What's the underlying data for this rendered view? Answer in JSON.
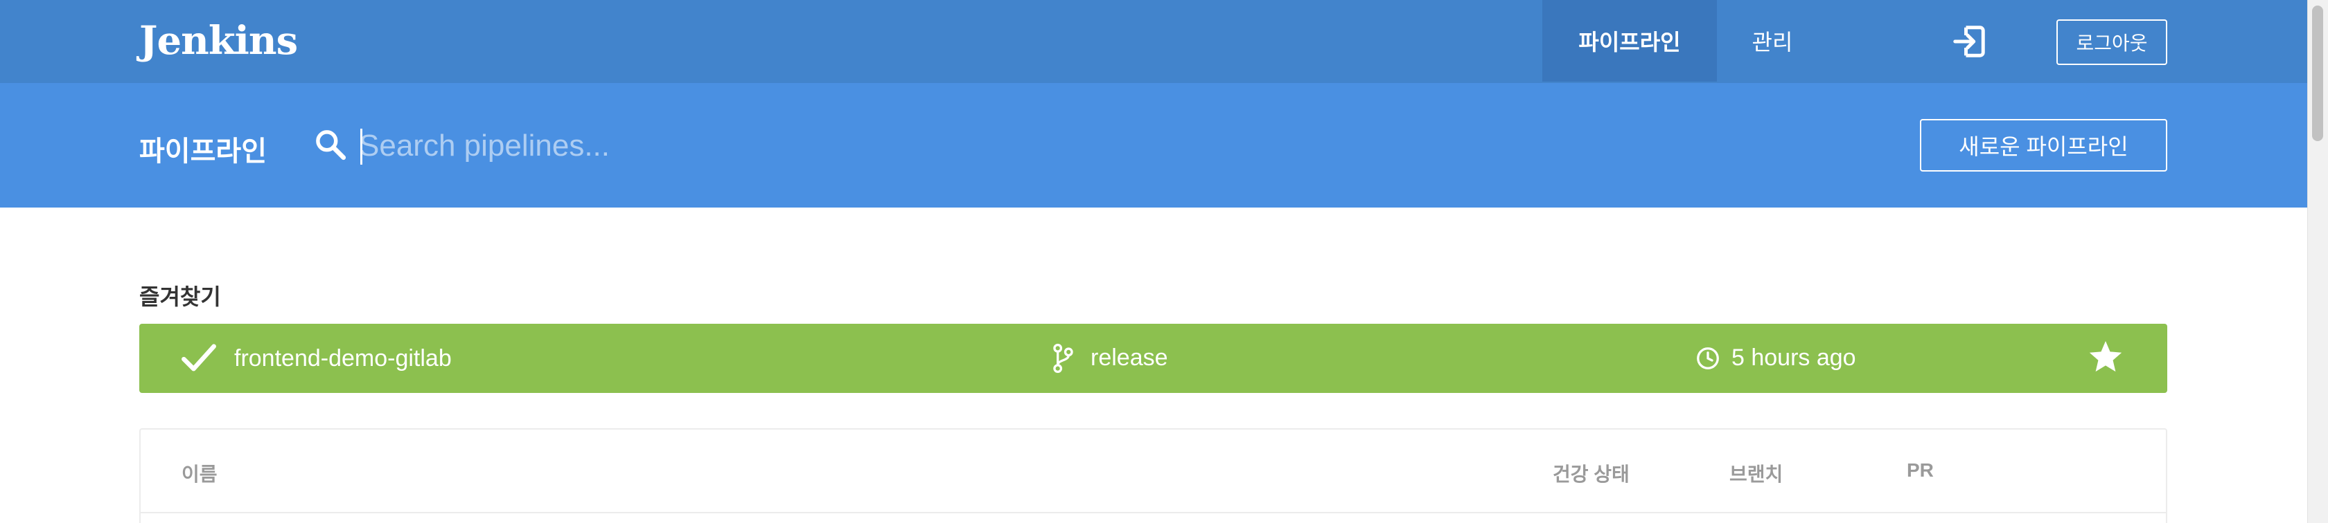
{
  "header": {
    "brand": "Jenkins",
    "nav": [
      {
        "label": "파이프라인",
        "active": true
      },
      {
        "label": "관리",
        "active": false
      }
    ],
    "exit_icon": "sign-out-icon",
    "logout_label": "로그아웃"
  },
  "subheader": {
    "title": "파이프라인",
    "search_icon": "search-icon",
    "search_placeholder": "Search pipelines...",
    "search_value": "",
    "new_pipeline_label": "새로운 파이프라인"
  },
  "favorites": {
    "heading": "즐겨찾기",
    "items": [
      {
        "status_icon": "check-icon",
        "name": "frontend-demo-gitlab",
        "branch_icon": "git-branch-icon",
        "branch": "release",
        "time_icon": "clock-icon",
        "time": "5 hours ago",
        "star_icon": "star-icon",
        "status_color": "#8cc04f"
      }
    ]
  },
  "table": {
    "columns": [
      "이름",
      "건강 상태",
      "브랜치",
      "PR"
    ]
  },
  "colors": {
    "topbar": "#4284cc",
    "subbar": "#4a90e2",
    "active_tab": "#3a77bd",
    "success": "#8cc04f"
  }
}
